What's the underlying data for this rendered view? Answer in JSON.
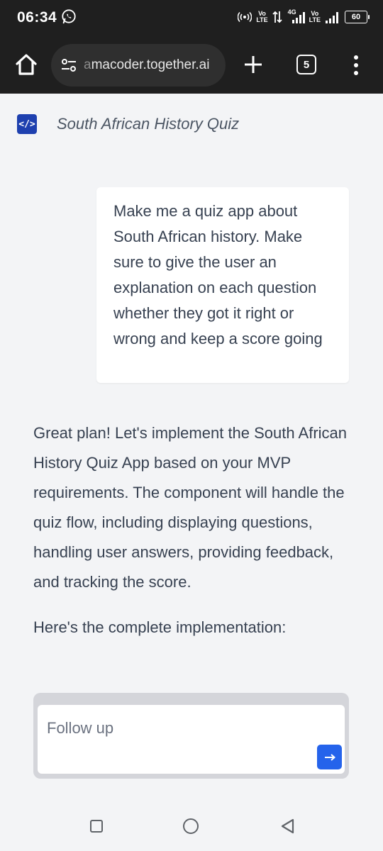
{
  "status_bar": {
    "time": "06:34",
    "sim1_label_top": "Vo",
    "sim1_label_bottom": "LTE",
    "network_type": "4G",
    "sim2_label_top": "Vo",
    "sim2_label_bottom": "LTE",
    "battery_level": "60",
    "icons": [
      "whatsapp-icon",
      "hotspot-icon",
      "data-arrows-icon",
      "signal-icon",
      "signal-icon",
      "battery-icon"
    ]
  },
  "browser": {
    "url_prefix": "a",
    "url_main": "macoder.together.ai",
    "tab_count": "5",
    "icons": [
      "home-icon",
      "site-settings-icon",
      "plus-icon",
      "tabs-icon",
      "more-vertical-icon"
    ]
  },
  "app": {
    "logo_symbol": "</>",
    "title": "South African History Quiz"
  },
  "conversation": {
    "user_message": "Make me a quiz app about South African history. Make sure to give the user an explanation on each question whether they got it right or wrong and keep a score going",
    "assistant_paragraph_1": "Great plan! Let's implement the South African History Quiz App based on your MVP requirements. The component will handle the quiz flow, including displaying questions, handling user answers, providing feedback, and tracking the score.",
    "assistant_paragraph_2": "Here's the complete implementation:"
  },
  "composer": {
    "placeholder": "Follow up",
    "value": "",
    "send_icon": "arrow-right-icon",
    "accent_color": "#2563eb"
  },
  "nav_bar": {
    "icons": [
      "recents-icon",
      "home-circle-icon",
      "back-icon"
    ]
  }
}
